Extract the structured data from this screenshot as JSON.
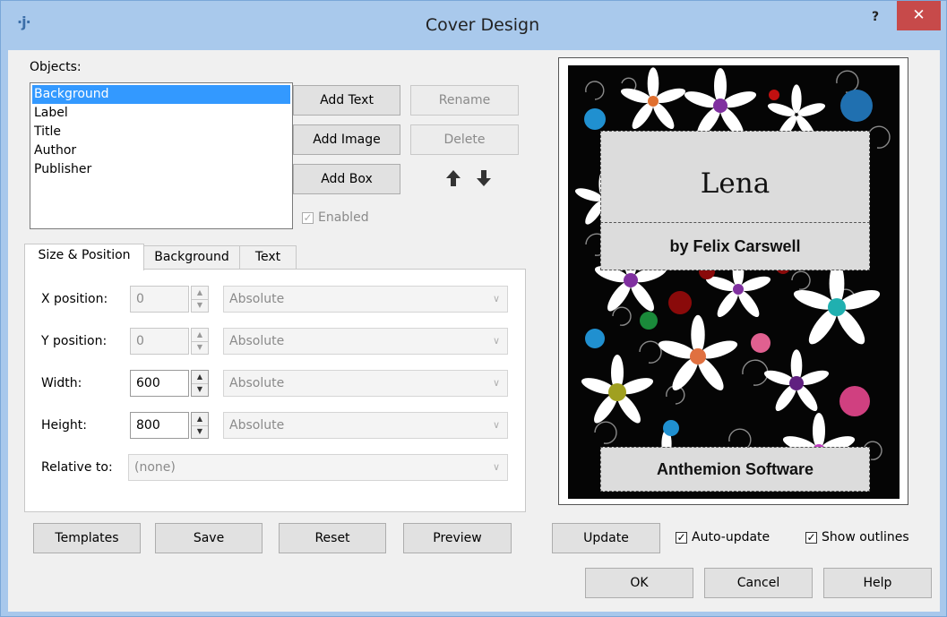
{
  "window": {
    "title": "Cover Design",
    "app_icon": "·j·",
    "help_glyph": "?",
    "close_glyph": "✕"
  },
  "objects": {
    "label": "Objects:",
    "items": [
      "Background",
      "Label",
      "Title",
      "Author",
      "Publisher"
    ],
    "selected_index": 0
  },
  "buttons": {
    "add_text": "Add Text",
    "add_image": "Add Image",
    "add_box": "Add Box",
    "rename": "Rename",
    "delete": "Delete",
    "enabled_label": "Enabled",
    "enabled_checked": true
  },
  "tabs": [
    "Size & Position",
    "Background",
    "Text"
  ],
  "size_position": {
    "x": {
      "label": "X position:",
      "value": "0",
      "mode": "Absolute"
    },
    "y": {
      "label": "Y position:",
      "value": "0",
      "mode": "Absolute"
    },
    "width": {
      "label": "Width:",
      "value": "600",
      "mode": "Absolute"
    },
    "height": {
      "label": "Height:",
      "value": "800",
      "mode": "Absolute"
    },
    "relative": {
      "label": "Relative to:",
      "value": "(none)"
    }
  },
  "bottom_buttons": {
    "templates": "Templates",
    "save": "Save",
    "reset": "Reset",
    "preview": "Preview",
    "update": "Update"
  },
  "options": {
    "auto_update": "Auto-update",
    "show_outlines": "Show outlines"
  },
  "dialog_buttons": {
    "ok": "OK",
    "cancel": "Cancel",
    "help": "Help"
  },
  "cover": {
    "title": "Lena",
    "author": "by Felix Carswell",
    "publisher": "Anthemion Software"
  },
  "colors": {
    "selection": "#3399ff",
    "title_bar": "#a9c9ec",
    "close": "#c74a4a"
  }
}
